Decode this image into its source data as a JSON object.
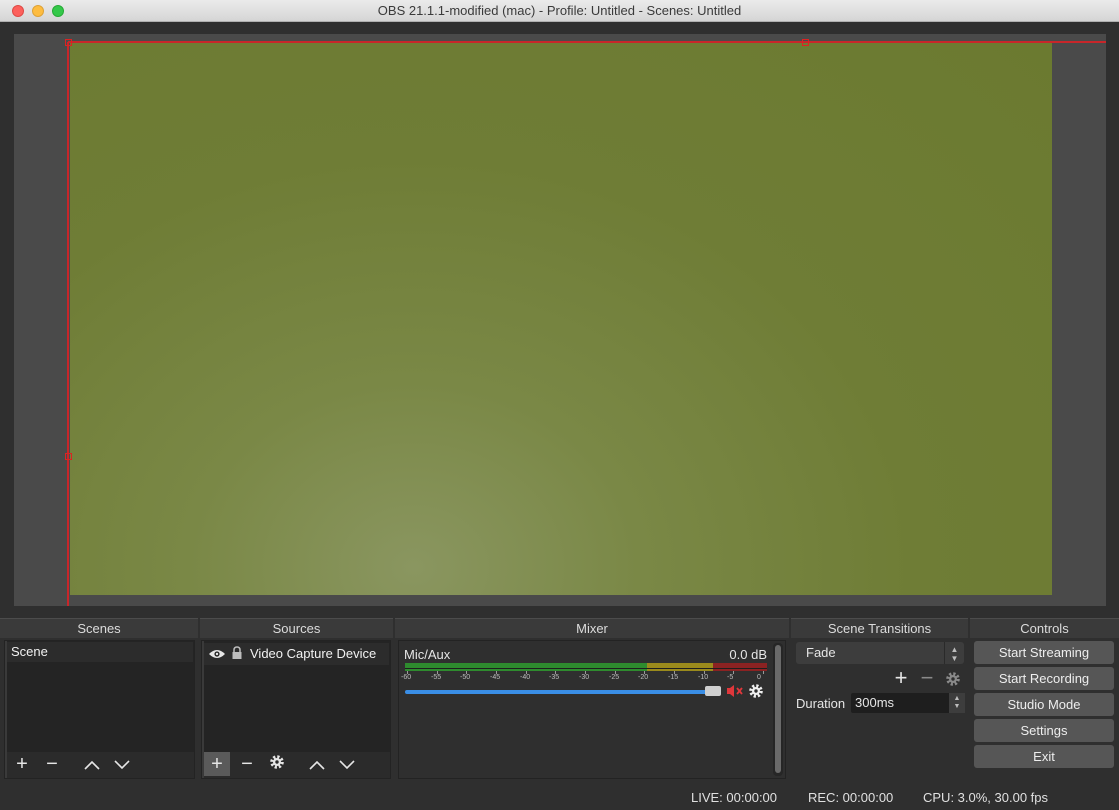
{
  "window": {
    "title": "OBS 21.1.1-modified (mac) - Profile: Untitled - Scenes: Untitled"
  },
  "docks": {
    "scenes": "Scenes",
    "sources": "Sources",
    "mixer": "Mixer",
    "transitions": "Scene Transitions",
    "controls": "Controls"
  },
  "scenes": {
    "items": [
      "Scene"
    ]
  },
  "sources": {
    "items": [
      {
        "label": "Video Capture Device",
        "visible": true,
        "locked": true
      }
    ]
  },
  "mixer": {
    "channel": "Mic/Aux",
    "db": "0.0 dB",
    "ticks": [
      "-60",
      "-55",
      "-50",
      "-45",
      "-40",
      "-35",
      "-30",
      "-25",
      "-20",
      "-15",
      "-10",
      "-5",
      "0"
    ],
    "volume_level": 1.0,
    "muted": true
  },
  "transitions": {
    "selected": "Fade",
    "duration_label": "Duration",
    "duration_value": "300ms"
  },
  "controls": {
    "start_streaming": "Start Streaming",
    "start_recording": "Start Recording",
    "studio_mode": "Studio Mode",
    "settings": "Settings",
    "exit": "Exit"
  },
  "status": {
    "live": "LIVE: 00:00:00",
    "rec": "REC: 00:00:00",
    "cpu": "CPU: 3.0%, 30.00 fps"
  },
  "colors": {
    "selection": "#c8262a",
    "video": "#6f7d36",
    "meter_green": "#2e8b2e",
    "meter_yellow": "#9a8a1c",
    "meter_red": "#8b2222",
    "slider": "#3a8ee6",
    "mute": "#e0373b"
  }
}
